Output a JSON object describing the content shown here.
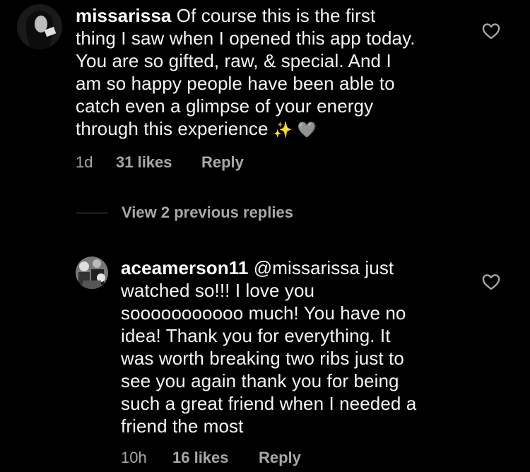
{
  "comments": [
    {
      "username": "missarissa",
      "text_lines": [
        " Of course this is the first",
        "thing I saw when I opened this app today.",
        "You are so gifted, raw, & special. And I",
        "am so happy people have been able to",
        "catch even a glimpse of your energy",
        "through this experience "
      ],
      "emoji": "✨ 🩶",
      "time": "1d",
      "likes": "31 likes",
      "reply_label": "Reply"
    },
    {
      "username": "aceamerson11",
      "text_lines": [
        " @missarissa just",
        "watched so!!! I love you",
        "sooooooooooo much! You have no",
        "idea! Thank you for everything. It",
        "was worth breaking two ribs just to",
        "see you again thank you for being",
        "such a great friend when I needed a",
        "friend the most"
      ],
      "time": "10h",
      "likes": "16 likes",
      "reply_label": "Reply"
    }
  ],
  "view_replies": {
    "label": "View 2 previous replies"
  },
  "icons": {
    "like": "heart-outline-icon"
  },
  "colors": {
    "background": "#000000",
    "text": "#f5f5f5",
    "secondary": "#a8a8a8"
  }
}
